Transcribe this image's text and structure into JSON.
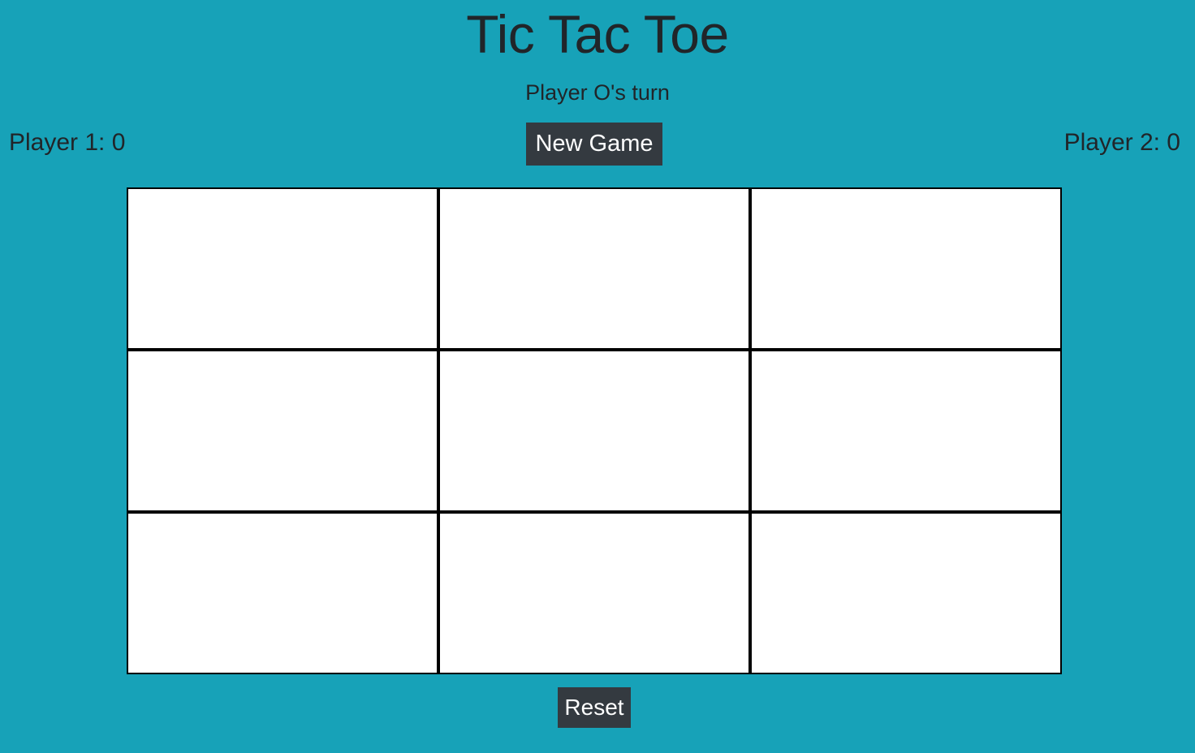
{
  "title": "Tic Tac Toe",
  "status": "Player O's turn",
  "scores": {
    "player1": "Player 1: 0",
    "player2": "Player 2: 0"
  },
  "buttons": {
    "new_game": "New Game",
    "reset": "Reset"
  },
  "board": {
    "cells": [
      "",
      "",
      "",
      "",
      "",
      "",
      "",
      "",
      ""
    ]
  },
  "colors": {
    "background": "#17a2b8",
    "button": "#343a40",
    "grid_lines": "#000000",
    "cell": "#ffffff"
  }
}
